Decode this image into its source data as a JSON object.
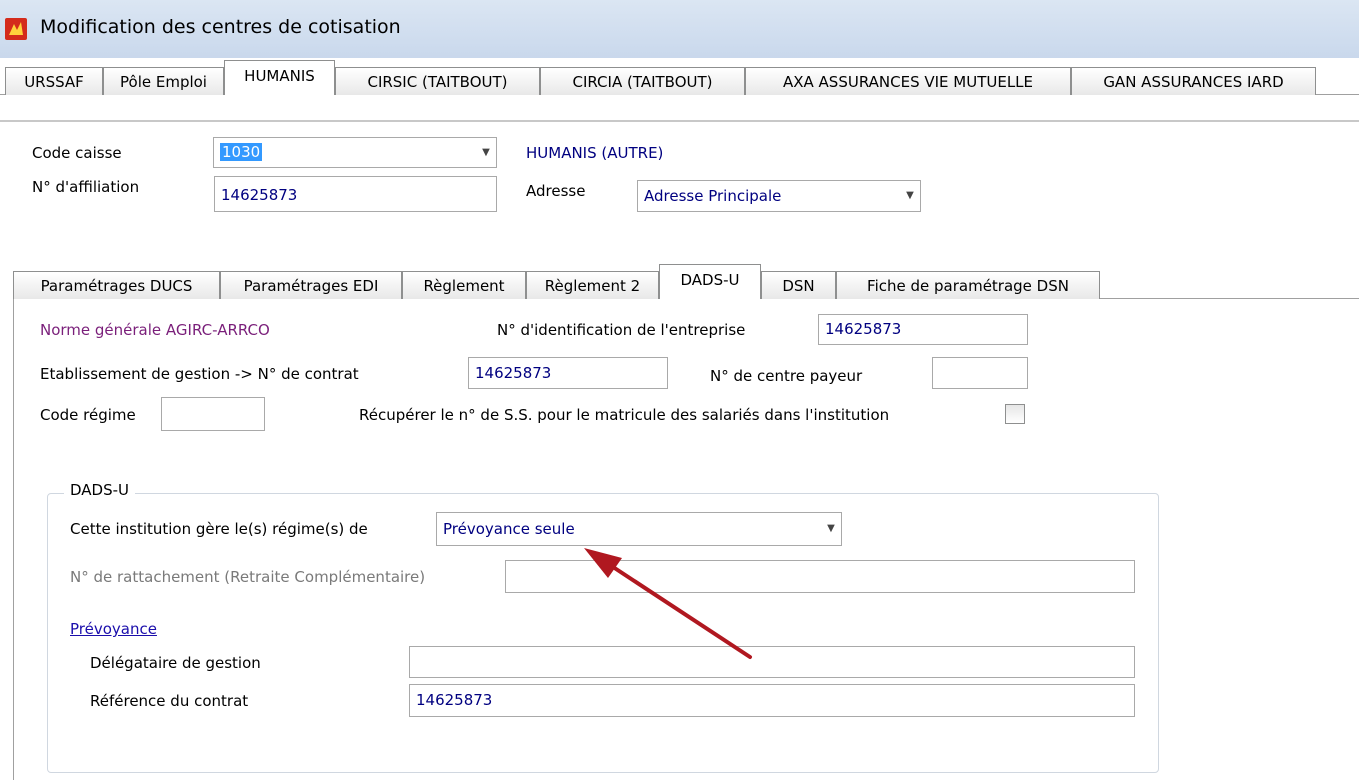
{
  "window": {
    "title": "Modification des centres de cotisation"
  },
  "main_tabs": [
    {
      "label": "URSSAF"
    },
    {
      "label": "Pôle Emploi"
    },
    {
      "label": "HUMANIS"
    },
    {
      "label": "CIRSIC (TAITBOUT)"
    },
    {
      "label": "CIRCIA (TAITBOUT)"
    },
    {
      "label": "AXA ASSURANCES VIE MUTUELLE"
    },
    {
      "label": "GAN ASSURANCES IARD"
    }
  ],
  "header_form": {
    "code_caisse_label": "Code caisse",
    "code_caisse_value": "1030",
    "caisse_name": "HUMANIS (AUTRE)",
    "affiliation_label": "N° d'affiliation",
    "affiliation_value": "14625873",
    "adresse_label": "Adresse",
    "adresse_value": "Adresse Principale"
  },
  "sub_tabs": [
    {
      "label": "Paramétrages DUCS"
    },
    {
      "label": "Paramétrages EDI"
    },
    {
      "label": "Règlement"
    },
    {
      "label": "Règlement 2"
    },
    {
      "label": "DADS-U"
    },
    {
      "label": "DSN"
    },
    {
      "label": "Fiche de paramétrage DSN"
    }
  ],
  "dadsu": {
    "norme_label": "Norme générale AGIRC-ARRCO",
    "id_entreprise_label": "N° d'identification de l'entreprise",
    "id_entreprise_value": "14625873",
    "etab_label": "Etablissement de gestion  ->  N° de contrat",
    "contrat_value": "14625873",
    "centre_payeur_label": "N° de centre payeur",
    "centre_payeur_value": "",
    "code_regime_label": "Code régime",
    "code_regime_value": "",
    "recuperer_label": "Récupérer le n° de S.S. pour le matricule des salariés dans l'institution",
    "recuperer_checked": false
  },
  "group": {
    "title": "DADS-U",
    "regime_label": "Cette institution gère le(s) régime(s) de",
    "regime_value": "Prévoyance seule",
    "rattachement_label": "N° de rattachement (Retraite Complémentaire)",
    "rattachement_value": "",
    "prevoyance_link": "Prévoyance",
    "delegataire_label": "Délégataire de gestion",
    "delegataire_value": "",
    "reference_label": "Référence du contrat",
    "reference_value": "14625873"
  },
  "colors": {
    "annotation_arrow": "#b01820"
  }
}
